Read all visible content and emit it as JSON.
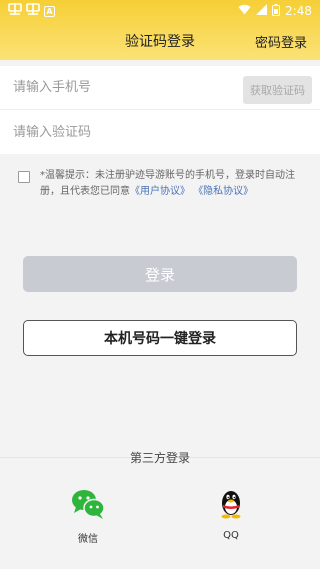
{
  "status_bar": {
    "left_icons": [
      "app-glyph-icon",
      "app-glyph-icon",
      "a-notification-icon"
    ],
    "time": "2:48"
  },
  "header": {
    "title": "验证码登录",
    "password_login": "密码登录",
    "gradient_top": "#f6cf35",
    "gradient_bottom": "#fbe276"
  },
  "form": {
    "phone_placeholder": "请输入手机号",
    "code_placeholder": "请输入验证码",
    "get_code_label": "获取验证码"
  },
  "agreement": {
    "checked": false,
    "text_prefix": "*温馨提示：未注册驴迹导游账号的手机号，登录时自动注册，且代表您已同意",
    "user_agreement": "《用户协议》",
    "privacy_agreement": "《隐私协议》",
    "link_color": "#4a74b8"
  },
  "buttons": {
    "login": "登录",
    "one_key_login": "本机号码一键登录"
  },
  "third_party": {
    "title": "第三方登录",
    "wechat": "微信",
    "qq": "QQ"
  }
}
